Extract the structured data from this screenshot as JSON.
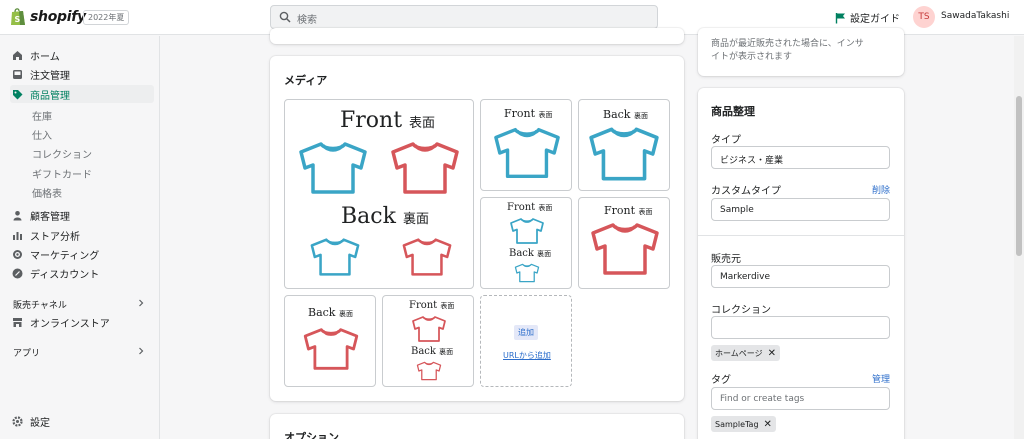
{
  "topbar": {
    "brand": "shopify",
    "edition": "2022年夏",
    "search_placeholder": "検索",
    "guide_label": "設定ガイド",
    "avatar_initials": "TS",
    "username": "SawadaTakashi"
  },
  "sidebar": {
    "items": [
      {
        "label": "ホーム",
        "icon": "home-icon"
      },
      {
        "label": "注文管理",
        "icon": "inbox-icon"
      },
      {
        "label": "商品管理",
        "icon": "tag-icon",
        "active": true
      }
    ],
    "sub_items": [
      "在庫",
      "仕入",
      "コレクション",
      "ギフトカード",
      "価格表"
    ],
    "items2": [
      {
        "label": "顧客管理",
        "icon": "person-icon"
      },
      {
        "label": "ストア分析",
        "icon": "bar-chart-icon"
      },
      {
        "label": "マーケティング",
        "icon": "target-icon"
      },
      {
        "label": "ディスカウント",
        "icon": "discount-icon"
      }
    ],
    "sales_channels_label": "販売チャネル",
    "online_store": "オンラインストア",
    "apps_label": "アプリ",
    "settings": "設定"
  },
  "media": {
    "title": "メディア",
    "tiles": [
      {
        "lines": [
          {
            "en": "Front",
            "jp": "表面"
          },
          {
            "en": "Back",
            "jp": "裏面"
          }
        ]
      },
      {
        "lines": [
          {
            "en": "Front",
            "jp": "表面"
          }
        ]
      },
      {
        "lines": [
          {
            "en": "Back",
            "jp": "裏面"
          }
        ]
      },
      {
        "lines": [
          {
            "en": "Front",
            "jp": "表面"
          },
          {
            "en": "Back",
            "jp": "裏面"
          }
        ]
      },
      {
        "lines": [
          {
            "en": "Front",
            "jp": "表面"
          }
        ]
      },
      {
        "lines": [
          {
            "en": "Back",
            "jp": "裏面"
          }
        ]
      },
      {
        "lines": [
          {
            "en": "Front",
            "jp": "表面"
          },
          {
            "en": "Back",
            "jp": "裏面"
          }
        ]
      }
    ],
    "add_label": "追加",
    "add_url_label": "URLから追加"
  },
  "options": {
    "title": "オプション"
  },
  "insights": {
    "text_line1": "商品が最近販売された場合に、インサ",
    "text_line2": "イトが表示されます"
  },
  "organization": {
    "title": "商品整理",
    "type_label": "タイプ",
    "type_value": "ビジネス・産業",
    "custom_type_label": "カスタムタイプ",
    "custom_type_delete": "削除",
    "custom_type_value": "Sample",
    "vendor_label": "販売元",
    "vendor_value": "Markerdive",
    "collection_label": "コレクション",
    "collection_value": "",
    "collection_pill": "ホームページ",
    "tags_label": "タグ",
    "tags_manage": "管理",
    "tags_placeholder": "Find or create tags",
    "tag_pill": "SampleTag"
  },
  "colors": {
    "shirt_blue": "#3aa5c6",
    "shirt_red": "#d6565a",
    "accent_green": "#008060",
    "link_blue": "#2c6ecb"
  }
}
